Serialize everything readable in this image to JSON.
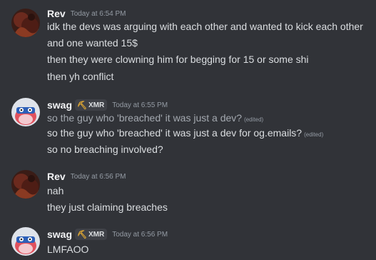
{
  "messages": [
    {
      "username": "Rev",
      "avatar_icon": "rev-avatar",
      "timestamp": "Today at 6:54 PM",
      "lines": [
        {
          "text": "idk the devs was arguing with each other and wanted to kick each other"
        },
        {
          "text": "and one wanted 15$"
        },
        {
          "text": "then they were clowning him for begging for 15 or some shi"
        },
        {
          "text": "then yh conflict"
        }
      ]
    },
    {
      "username": "swag",
      "avatar_icon": "swag-avatar",
      "tag": {
        "icon": "pickaxe-icon",
        "label": "XMR"
      },
      "timestamp": "Today at 6:55 PM",
      "lines": [
        {
          "text": "so the guy who 'breached' it was just a dev?",
          "edited": "(edited)"
        },
        {
          "text": "so the guy who 'breached' it was just a dev for og.emails?",
          "edited": "(edited)"
        },
        {
          "text": "so no breaching involved?"
        }
      ]
    },
    {
      "username": "Rev",
      "avatar_icon": "rev-avatar",
      "timestamp": "Today at 6:56 PM",
      "lines": [
        {
          "text": "nah"
        },
        {
          "text": "they just claiming breaches"
        }
      ]
    },
    {
      "username": "swag",
      "avatar_icon": "swag-avatar",
      "tag": {
        "icon": "pickaxe-icon",
        "label": "XMR"
      },
      "timestamp": "Today at 6:56 PM",
      "lines": [
        {
          "text": "LMFAOO"
        }
      ]
    }
  ],
  "colors": {
    "background": "#313338",
    "username": "#f2f3f5",
    "message_text": "#dbdee1",
    "timestamp": "#949ba4",
    "tag_background": "#3f4147"
  }
}
